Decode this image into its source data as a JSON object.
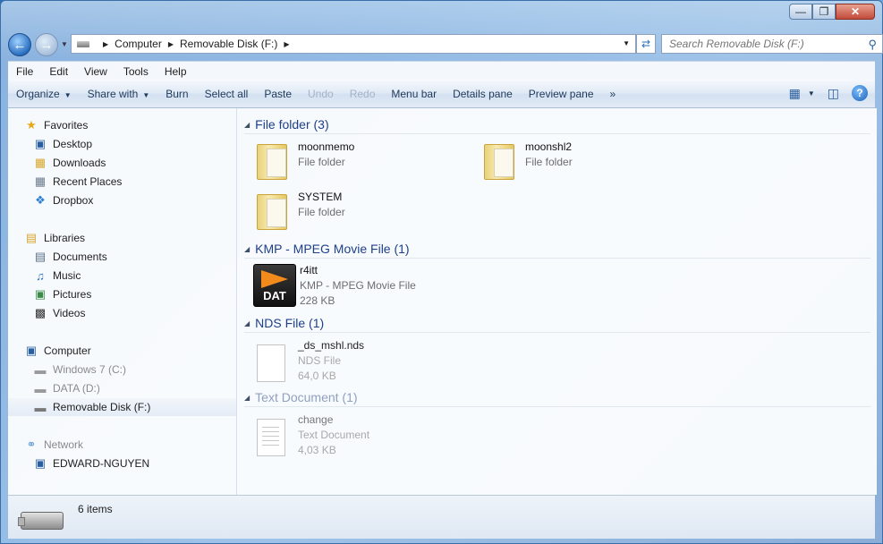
{
  "window": {
    "caption_buttons": [
      "—",
      "❐",
      "✕"
    ]
  },
  "address": {
    "crumbs": [
      "Computer",
      "Removable Disk (F:)"
    ],
    "search_placeholder": "Search Removable Disk (F:)"
  },
  "menubar": [
    "File",
    "Edit",
    "View",
    "Tools",
    "Help"
  ],
  "commands": {
    "organize": "Organize",
    "share_with": "Share with",
    "burn": "Burn",
    "select_all": "Select all",
    "paste": "Paste",
    "undo": "Undo",
    "redo": "Redo",
    "menu_bar": "Menu bar",
    "details_pane": "Details pane",
    "preview_pane": "Preview pane",
    "more": "»"
  },
  "navigation": {
    "favorites": {
      "label": "Favorites",
      "items": [
        "Desktop",
        "Downloads",
        "Recent Places",
        "Dropbox"
      ]
    },
    "libraries": {
      "label": "Libraries",
      "items": [
        "Documents",
        "Music",
        "Pictures",
        "Videos"
      ]
    },
    "computer": {
      "label": "Computer",
      "items": [
        "Windows 7 (C:)",
        "DATA (D:)",
        "Removable Disk (F:)"
      ]
    },
    "network": {
      "label": "Network",
      "items": [
        "EDWARD-NGUYEN"
      ]
    }
  },
  "groups": [
    {
      "label": "File folder (3)"
    },
    {
      "label": "KMP - MPEG Movie File (1)"
    },
    {
      "label": "NDS File (1)"
    },
    {
      "label": "Text Document (1)"
    }
  ],
  "files": {
    "moonmemo": {
      "name": "moonmemo",
      "type": "File folder"
    },
    "moonshl2": {
      "name": "moonshl2",
      "type": "File folder"
    },
    "system": {
      "name": "SYSTEM",
      "type": "File folder"
    },
    "r4itt": {
      "name": "r4itt",
      "type": "KMP - MPEG Movie File",
      "size": "228 KB",
      "icon_text": "DAT"
    },
    "ds_mshl": {
      "name": "_ds_mshl.nds",
      "type": "NDS File",
      "size": "64,0 KB"
    },
    "change": {
      "name": "change",
      "type": "Text Document",
      "size": "4,03 KB"
    }
  },
  "status": {
    "item_count": "6 items"
  }
}
